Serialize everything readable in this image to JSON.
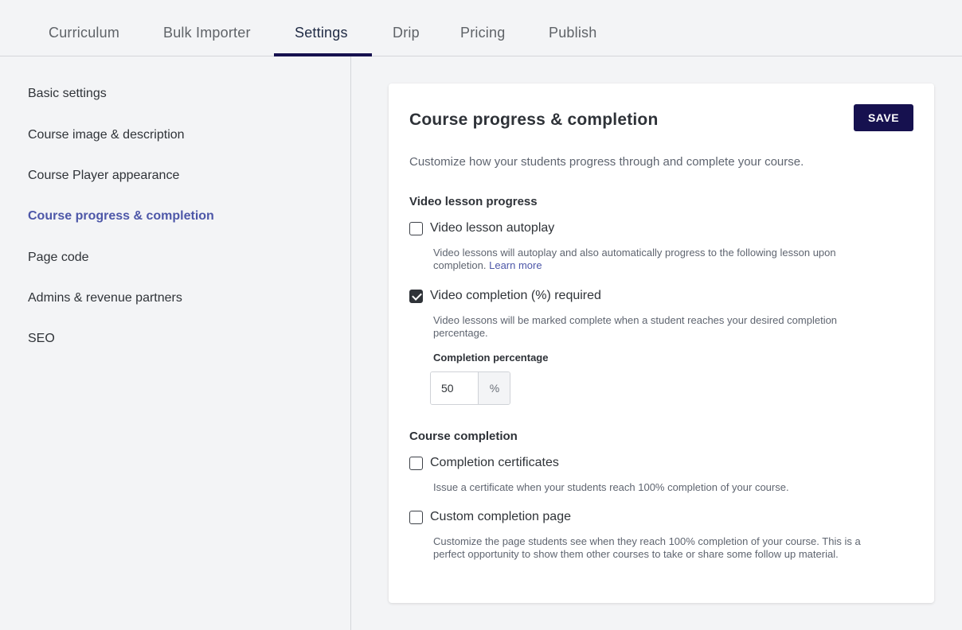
{
  "tabs": [
    {
      "label": "Curriculum"
    },
    {
      "label": "Bulk Importer"
    },
    {
      "label": "Settings"
    },
    {
      "label": "Drip"
    },
    {
      "label": "Pricing"
    },
    {
      "label": "Publish"
    }
  ],
  "active_tab": "Settings",
  "sidebar": {
    "items": [
      {
        "label": "Basic settings"
      },
      {
        "label": "Course image & description"
      },
      {
        "label": "Course Player appearance"
      },
      {
        "label": "Course progress & completion"
      },
      {
        "label": "Page code"
      },
      {
        "label": "Admins & revenue partners"
      },
      {
        "label": "SEO"
      }
    ],
    "active": "Course progress & completion"
  },
  "panel": {
    "title": "Course progress & completion",
    "save_label": "SAVE",
    "description": "Customize how your students progress through and complete your course.",
    "video_section": {
      "title": "Video lesson progress",
      "autoplay": {
        "label": "Video lesson autoplay",
        "checked": false,
        "help": "Video lessons will autoplay and also automatically progress to the following lesson upon completion.",
        "help_link": "Learn more"
      },
      "completion_required": {
        "label": "Video completion (%) required",
        "checked": true,
        "help": "Video lessons will be marked complete when a student reaches your desired completion percentage."
      },
      "percentage": {
        "label": "Completion percentage",
        "value": "50",
        "suffix": "%"
      }
    },
    "course_section": {
      "title": "Course completion",
      "certificates": {
        "label": "Completion certificates",
        "checked": false,
        "help": "Issue a certificate when your students reach 100% completion of your course."
      },
      "custom_page": {
        "label": "Custom completion page",
        "checked": false,
        "help": "Customize the page students see when they reach 100% completion of your course. This is a perfect opportunity to show them other courses to take or share some follow up material."
      }
    }
  },
  "colors": {
    "accent": "#16114f",
    "link": "#4d57a8",
    "background": "#f3f4f6"
  }
}
